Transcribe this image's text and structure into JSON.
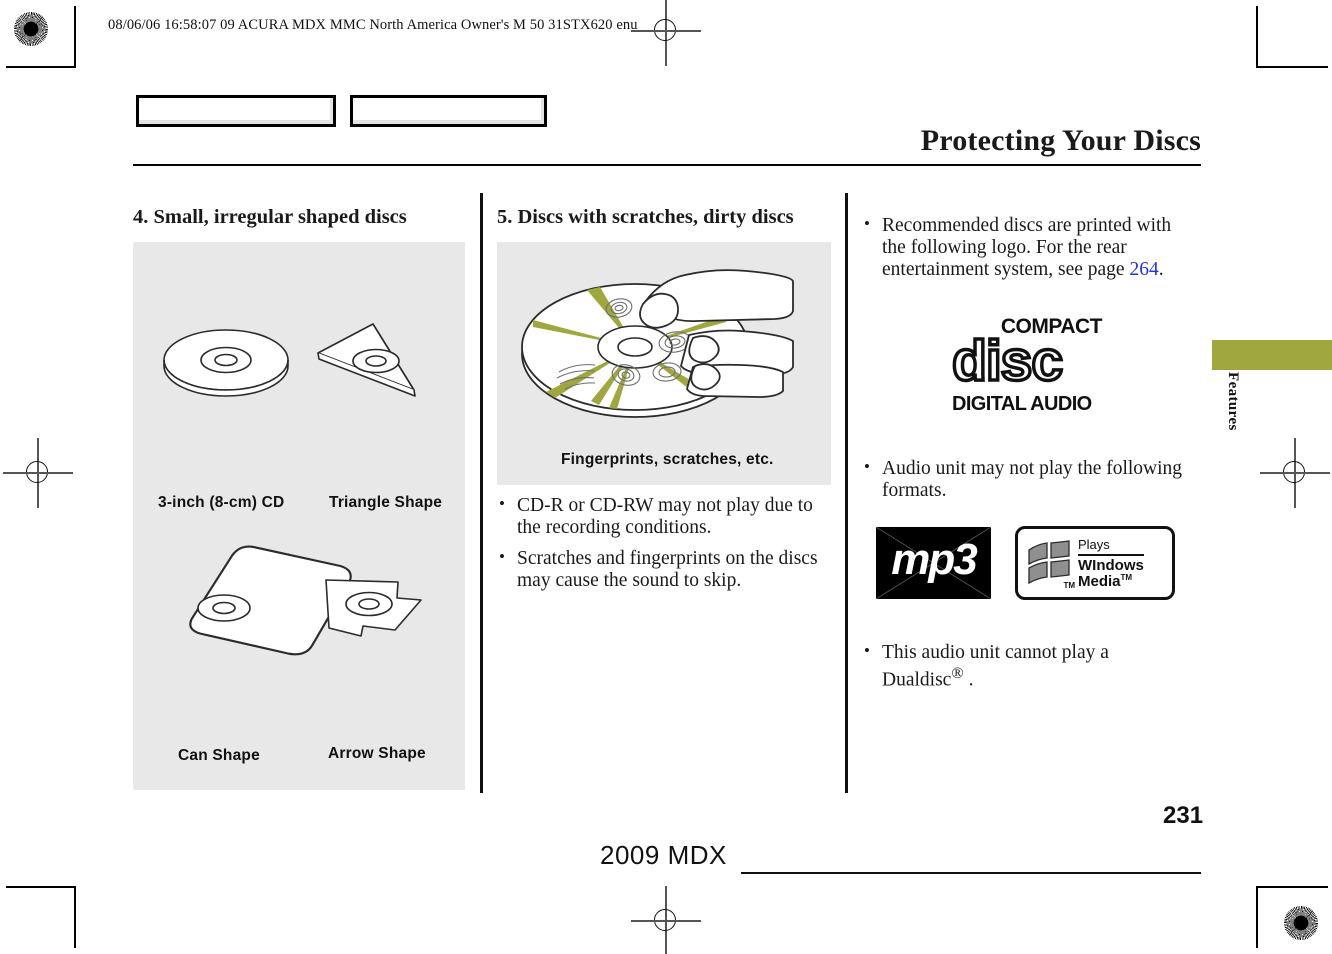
{
  "slug": {
    "text": "08/06/06 16:58:07   09 ACURA MDX MMC North America Owner's M 50 31STX620 enu"
  },
  "tabs": [
    {
      "name": "tab-box-left",
      "label": ""
    },
    {
      "name": "tab-box-right",
      "label": ""
    }
  ],
  "header": {
    "title": "Protecting Your Discs"
  },
  "columns": {
    "left": {
      "heading": "4. Small, irregular shaped discs",
      "figure_captions": [
        "3-inch (8-cm) CD",
        "Triangle Shape",
        "Can Shape",
        "Arrow Shape"
      ]
    },
    "middle": {
      "heading": "5. Discs with scratches, dirty discs",
      "figure_caption": "Fingerprints, scratches, etc.",
      "bullets": [
        "CD-R or CD-RW may not play due to the recording conditions.",
        "Scratches and fingerprints on the discs may cause the sound to skip."
      ]
    },
    "right": {
      "bullet_1_part_1": "Recommended discs are printed with the following logo. For the rear entertainment system, see page ",
      "bullet_1_page_ref": "264",
      "bullet_1_part_2": ".",
      "cd_logo": {
        "top": "COMPACT",
        "middle": "disc",
        "bottom": "DIGITAL AUDIO"
      },
      "bullet_2": "Audio unit may not play the following formats.",
      "format_logos": {
        "mp3": "mp3",
        "windows_media": {
          "plays": "Plays",
          "windows": "WIndows",
          "media": "Media",
          "tm_media": "TM",
          "tm_flag": "TM"
        }
      },
      "bullet_3_part_1": "This audio unit cannot play a Dualdisc",
      "bullet_3_reg": "®",
      "bullet_3_part_2": " ."
    }
  },
  "side_tab": {
    "label": "Features",
    "color": "#9fa83f"
  },
  "footer": {
    "model": "2009  MDX",
    "page_number": "231"
  },
  "colors": {
    "figure_background": "#e8e8e8",
    "page_link": "#2233dd",
    "accent_olive": "#9fa83f"
  }
}
